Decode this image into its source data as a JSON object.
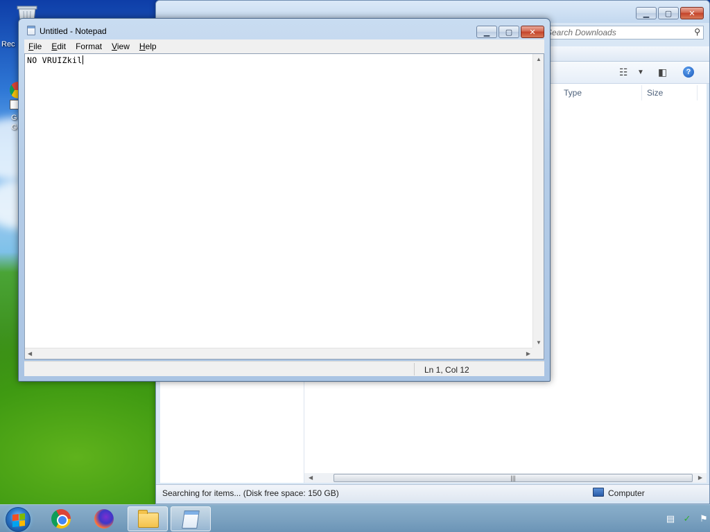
{
  "desktop": {
    "icons": [
      {
        "label": "Rec"
      },
      {
        "label": "G"
      }
    ]
  },
  "explorer": {
    "search_placeholder": "Search Downloads",
    "columns": [
      "Type",
      "Size"
    ],
    "status_text": "Searching for items... (Disk free space: 150 GB)",
    "location_label": "Computer",
    "scroll_grip": "|||"
  },
  "notepad": {
    "title": "Untitled - Notepad",
    "menu": [
      {
        "underline": "F",
        "rest": "ile"
      },
      {
        "underline": "E",
        "rest": "dit"
      },
      {
        "underline": "F",
        "rest": "ormat",
        "prefix": "",
        "full": "Format",
        "ul_index": 1
      },
      {
        "underline": "V",
        "rest": "iew"
      },
      {
        "underline": "H",
        "rest": "elp"
      }
    ],
    "text": "NO VRUIZkil",
    "status_position": "Ln 1, Col 12"
  },
  "taskbar": {
    "apps": [
      "Google Chrome",
      "Firefox",
      "Windows Explorer",
      "Notepad"
    ]
  },
  "colors": {
    "titlebar": "#c9dcf1",
    "close_button": "#c4432a",
    "taskbar": "#7ea4c2"
  }
}
